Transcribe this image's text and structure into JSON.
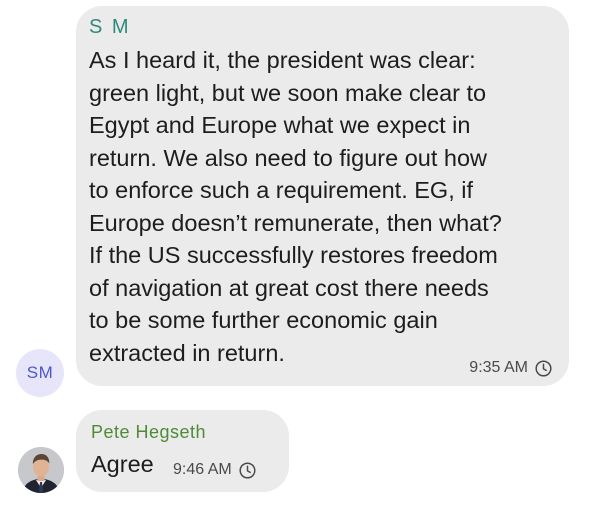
{
  "messages": [
    {
      "sender": "S M",
      "avatar_initials": "SM",
      "lines": [
        "As I heard it, the president was clear:",
        "green light, but we soon make clear to",
        "Egypt and Europe what we expect in",
        "return. We also need to figure out how",
        "to enforce such a requirement. EG, if",
        "Europe doesn’t remunerate, then what?",
        "If the US successfully restores freedom",
        "of navigation at great cost there needs",
        "to be some further economic gain",
        "extracted in return."
      ],
      "time": "9:35 AM",
      "status_icon": "clock-icon"
    },
    {
      "sender": "Pete Hegseth",
      "avatar": "profile-photo",
      "text": "Agree",
      "time": "9:46 AM",
      "status_icon": "clock-icon"
    }
  ],
  "colors": {
    "bubble": "#ebebeb",
    "sender_sm": "#2f8a7d",
    "sender_pete": "#4e8a38",
    "avatar_sm_bg": "#e7e5fa",
    "avatar_sm_text": "#4c58c8"
  }
}
